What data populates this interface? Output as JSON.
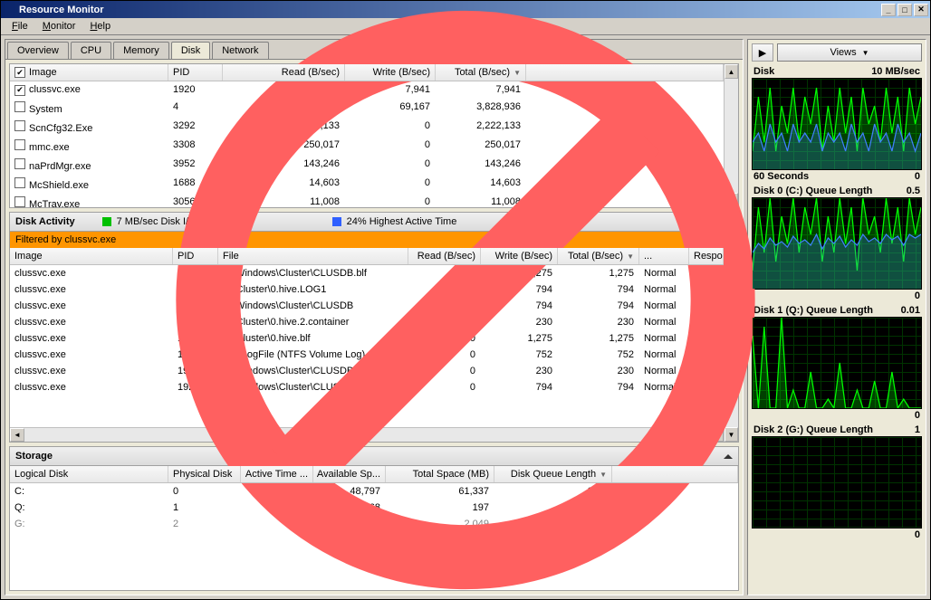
{
  "window": {
    "title": "Resource Monitor"
  },
  "menu": {
    "file": "File",
    "monitor": "Monitor",
    "help": "Help"
  },
  "tabs": {
    "overview": "Overview",
    "cpu": "CPU",
    "memory": "Memory",
    "disk": "Disk",
    "network": "Network"
  },
  "processes": {
    "columns": {
      "image": "Image",
      "pid": "PID",
      "read": "Read (B/sec)",
      "write": "Write (B/sec)",
      "total": "Total (B/sec)"
    },
    "rows": [
      {
        "checked": true,
        "image": "clussvc.exe",
        "pid": "1920",
        "read": "0",
        "write": "7,941",
        "total": "7,941"
      },
      {
        "checked": false,
        "image": "System",
        "pid": "4",
        "read": "3,759,769",
        "write": "69,167",
        "total": "3,828,936"
      },
      {
        "checked": false,
        "image": "ScnCfg32.Exe",
        "pid": "3292",
        "read": "2,222,133",
        "write": "0",
        "total": "2,222,133"
      },
      {
        "checked": false,
        "image": "mmc.exe",
        "pid": "3308",
        "read": "250,017",
        "write": "0",
        "total": "250,017"
      },
      {
        "checked": false,
        "image": "naPrdMgr.exe",
        "pid": "3952",
        "read": "143,246",
        "write": "0",
        "total": "143,246"
      },
      {
        "checked": false,
        "image": "McShield.exe",
        "pid": "1688",
        "read": "14,603",
        "write": "0",
        "total": "14,603"
      },
      {
        "checked": false,
        "image": "McTray.exe",
        "pid": "3056",
        "read": "11,008",
        "write": "0",
        "total": "11,008"
      }
    ]
  },
  "activity": {
    "title": "Disk Activity",
    "legend1": "7 MB/sec Disk I/O",
    "legend2": "24% Highest Active Time",
    "filter": "Filtered by clussvc.exe",
    "columns": {
      "image": "Image",
      "pid": "PID",
      "file": "File",
      "read": "Read (B/sec)",
      "write": "Write (B/sec)",
      "total": "Total (B/sec)",
      "priority": "...",
      "response": "Respon..."
    },
    "rows": [
      {
        "image": "clussvc.exe",
        "pid": "1920",
        "file": "C:\\Windows\\Cluster\\CLUSDB.blf",
        "read": "0",
        "write": "1,275",
        "total": "1,275",
        "priority": "Normal"
      },
      {
        "image": "clussvc.exe",
        "pid": "1920",
        "file": "Q:\\Cluster\\0.hive.LOG1",
        "read": "0",
        "write": "794",
        "total": "794",
        "priority": "Normal"
      },
      {
        "image": "clussvc.exe",
        "pid": "1920",
        "file": "C:\\Windows\\Cluster\\CLUSDB",
        "read": "0",
        "write": "794",
        "total": "794",
        "priority": "Normal"
      },
      {
        "image": "clussvc.exe",
        "pid": "1920",
        "file": "Q:\\Cluster\\0.hive.2.container",
        "read": "0",
        "write": "230",
        "total": "230",
        "priority": "Normal"
      },
      {
        "image": "clussvc.exe",
        "pid": "1920",
        "file": "Q:\\Cluster\\0.hive.blf",
        "read": "0",
        "write": "1,275",
        "total": "1,275",
        "priority": "Normal"
      },
      {
        "image": "clussvc.exe",
        "pid": "1920",
        "file": "Q:\\$LogFile (NTFS Volume Log)",
        "read": "0",
        "write": "752",
        "total": "752",
        "priority": "Normal"
      },
      {
        "image": "clussvc.exe",
        "pid": "1920",
        "file": "C:\\Windows\\Cluster\\CLUSDB.1.contai...",
        "read": "0",
        "write": "230",
        "total": "230",
        "priority": "Normal"
      },
      {
        "image": "clussvc.exe",
        "pid": "1920",
        "file": "C:\\Windows\\Cluster\\CLUSDB.LOG1",
        "read": "0",
        "write": "794",
        "total": "794",
        "priority": "Normal"
      }
    ]
  },
  "storage": {
    "title": "Storage",
    "columns": {
      "logical": "Logical Disk",
      "physical": "Physical Disk",
      "active": "Active Time ...",
      "avail": "Available Sp...",
      "total": "Total Space (MB)",
      "queue": "Disk Queue Length"
    },
    "rows": [
      {
        "logical": "C:",
        "physical": "0",
        "active": "23.52",
        "avail": "48,797",
        "total": "61,337",
        "queue": "0.25"
      },
      {
        "logical": "Q:",
        "physical": "1",
        "active": "0.28",
        "avail": "168",
        "total": "197",
        "queue": "0.00"
      },
      {
        "logical": "G:",
        "physical": "2",
        "active": "0.23",
        "avail": "1,991",
        "total": "2,049",
        "queue": "0.00",
        "gray": true
      }
    ]
  },
  "right": {
    "views": "Views",
    "charts": [
      {
        "title": "Disk",
        "right": "10 MB/sec",
        "footerL": "60 Seconds",
        "footerR": "0"
      },
      {
        "title": "Disk 0 (C:) Queue Length",
        "right": "0.5",
        "footerR": "0"
      },
      {
        "title": "Disk 1 (Q:) Queue Length",
        "right": "0.01",
        "footerR": "0"
      },
      {
        "title": "Disk 2 (G:) Queue Length",
        "right": "1",
        "footerR": "0"
      }
    ]
  },
  "chart_data": [
    {
      "type": "line",
      "title": "Disk",
      "ylabel": "MB/sec",
      "ylim": [
        0,
        10
      ],
      "xlim": [
        -60,
        0
      ],
      "series": [
        {
          "name": "Disk I/O",
          "color": "#00ff00",
          "values": [
            2,
            8,
            3,
            9,
            2,
            7,
            4,
            9,
            3,
            8,
            5,
            9,
            2,
            7,
            3,
            9,
            4,
            8,
            2,
            9,
            5,
            7,
            3,
            9,
            4,
            8,
            2,
            9,
            5,
            8
          ]
        },
        {
          "name": "Highest Active Time",
          "color": "#4080ff",
          "values": [
            3,
            4,
            2,
            5,
            3,
            4,
            2,
            5,
            3,
            4,
            3,
            5,
            2,
            4,
            3,
            4,
            2,
            5,
            3,
            4,
            2,
            5,
            3,
            4,
            2,
            5,
            3,
            4,
            2,
            4
          ]
        }
      ]
    },
    {
      "type": "line",
      "title": "Disk 0 (C:) Queue Length",
      "ylim": [
        0,
        0.5
      ],
      "series": [
        {
          "name": "queue",
          "color": "#00ff00",
          "values": [
            0.1,
            0.45,
            0.2,
            0.5,
            0.15,
            0.4,
            0.25,
            0.5,
            0.2,
            0.45,
            0.3,
            0.5,
            0.15,
            0.4,
            0.2,
            0.5,
            0.25,
            0.45,
            0.1,
            0.5,
            0.3,
            0.4,
            0.2,
            0.5,
            0.25,
            0.45,
            0.15,
            0.5,
            0.3,
            0.45
          ]
        },
        {
          "name": "avg",
          "color": "#4080ff",
          "values": [
            0.2,
            0.25,
            0.22,
            0.28,
            0.24,
            0.26,
            0.23,
            0.29,
            0.25,
            0.27,
            0.24,
            0.3,
            0.22,
            0.28,
            0.25,
            0.29,
            0.23,
            0.27,
            0.24,
            0.3,
            0.26,
            0.28,
            0.25,
            0.3,
            0.27,
            0.29,
            0.24,
            0.3,
            0.28,
            0.3
          ]
        }
      ]
    },
    {
      "type": "line",
      "title": "Disk 1 (Q:) Queue Length",
      "ylim": [
        0,
        0.01
      ],
      "series": [
        {
          "name": "queue",
          "color": "#00ff00",
          "values": [
            0.008,
            0,
            0.009,
            0,
            0,
            0.01,
            0,
            0.002,
            0,
            0,
            0.004,
            0,
            0,
            0.001,
            0,
            0.005,
            0,
            0,
            0.002,
            0,
            0,
            0.003,
            0,
            0,
            0.004,
            0,
            0.001,
            0,
            0,
            0
          ]
        }
      ]
    },
    {
      "type": "line",
      "title": "Disk 2 (G:) Queue Length",
      "ylim": [
        0,
        1
      ],
      "series": [
        {
          "name": "queue",
          "color": "#004400",
          "values": [
            0,
            0,
            0,
            0,
            0,
            0,
            0,
            0,
            0,
            0,
            0,
            0,
            0,
            0,
            0,
            0,
            0,
            0,
            0,
            0,
            0,
            0,
            0,
            0,
            0,
            0,
            0,
            0,
            0,
            0
          ]
        }
      ]
    }
  ]
}
